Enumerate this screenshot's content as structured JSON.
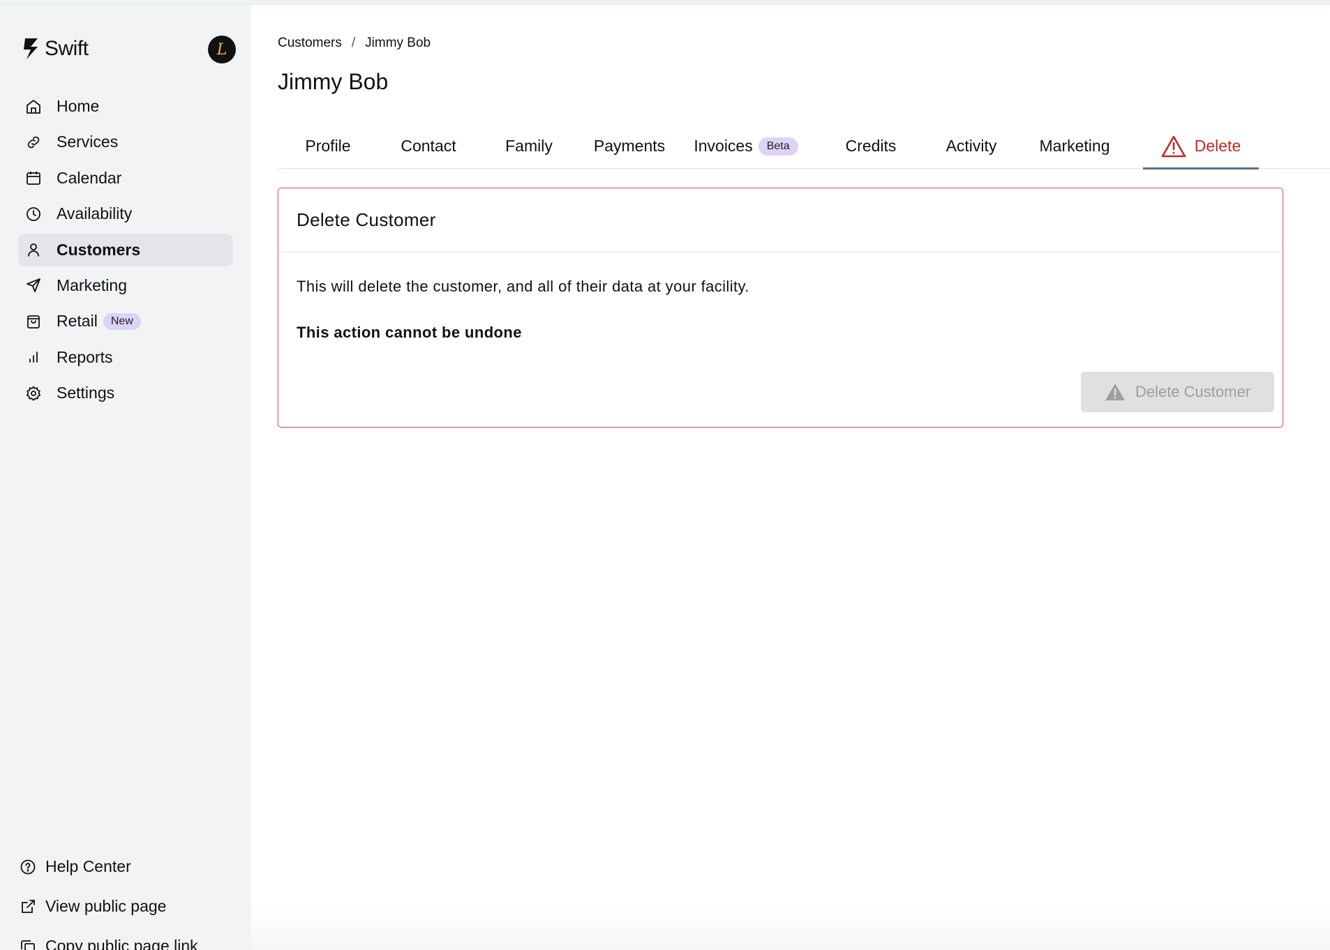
{
  "brand": {
    "name": "Swift",
    "avatar_initial": "L"
  },
  "sidebar": {
    "items": [
      {
        "label": "Home",
        "icon": "home-icon"
      },
      {
        "label": "Services",
        "icon": "link-icon"
      },
      {
        "label": "Calendar",
        "icon": "calendar-icon"
      },
      {
        "label": "Availability",
        "icon": "clock-icon"
      },
      {
        "label": "Customers",
        "icon": "user-icon",
        "active": true
      },
      {
        "label": "Marketing",
        "icon": "send-icon"
      },
      {
        "label": "Retail",
        "icon": "shopping-bag-icon",
        "badge": "New"
      },
      {
        "label": "Reports",
        "icon": "bar-chart-icon"
      },
      {
        "label": "Settings",
        "icon": "gear-icon"
      }
    ],
    "bottom": [
      {
        "label": "Help Center",
        "icon": "help-circle-icon"
      },
      {
        "label": "View public page",
        "icon": "external-link-icon"
      },
      {
        "label": "Copy public page link",
        "icon": "copy-icon"
      }
    ]
  },
  "breadcrumb": {
    "parent": "Customers",
    "separator": "/",
    "current": "Jimmy Bob"
  },
  "page": {
    "title": "Jimmy Bob"
  },
  "tabs": [
    {
      "label": "Profile"
    },
    {
      "label": "Contact"
    },
    {
      "label": "Family"
    },
    {
      "label": "Payments"
    },
    {
      "label": "Invoices",
      "badge": "Beta"
    },
    {
      "label": "Credits"
    },
    {
      "label": "Activity"
    },
    {
      "label": "Marketing"
    },
    {
      "label": "Delete",
      "active": true,
      "icon": "warning-icon"
    }
  ],
  "delete_card": {
    "title": "Delete Customer",
    "description": "This will delete the customer, and all of their data at your facility.",
    "warning": "This action cannot be undone",
    "button_label": "Delete Customer",
    "button_disabled": true
  },
  "colors": {
    "danger": "#c62828",
    "badge_bg": "#ddd3f7",
    "sidebar_bg": "#f2f3f5",
    "active_tab_underline": "#5b6f86"
  }
}
